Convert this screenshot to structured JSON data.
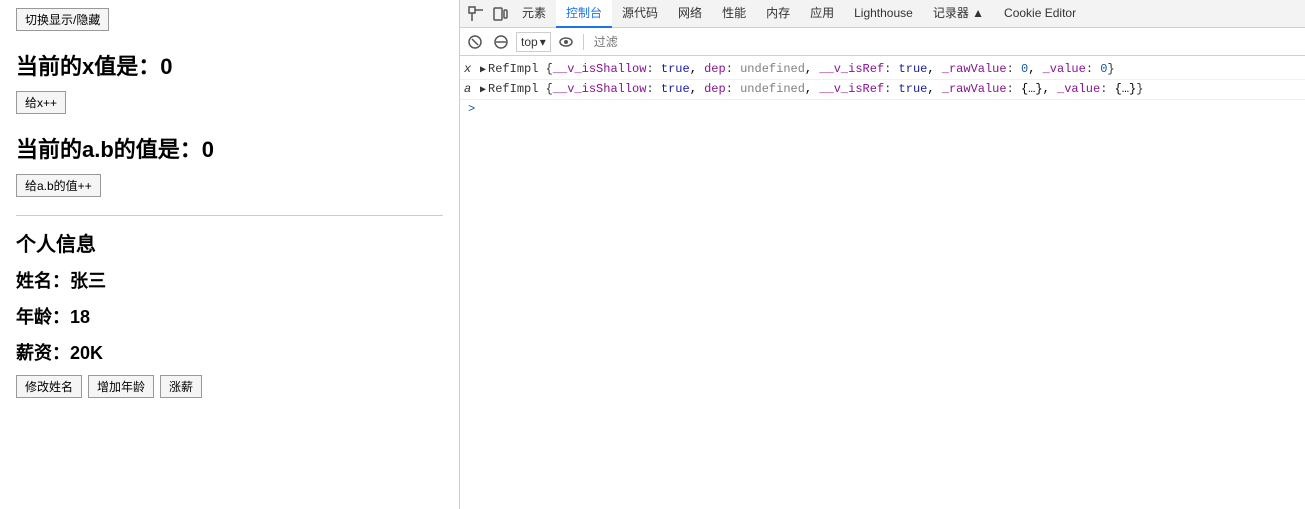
{
  "left": {
    "toggle_btn": "切换显示/隐藏",
    "current_x_label": "当前的x值是：",
    "current_x_value": "0",
    "x_increment_btn": "给x++",
    "current_ab_label": "当前的a.b的值是：",
    "current_ab_value": "0",
    "ab_increment_btn": "给a.b的值++",
    "section_title": "个人信息",
    "name_label": "姓名：张三",
    "age_label": "年龄：18",
    "salary_label": "薪资：20K",
    "btn_name": "修改姓名",
    "btn_age": "增加年龄",
    "btn_salary": "涨薪"
  },
  "devtools": {
    "tabs": [
      {
        "label": "元素",
        "active": false
      },
      {
        "label": "控制台",
        "active": true
      },
      {
        "label": "源代码",
        "active": false
      },
      {
        "label": "网络",
        "active": false
      },
      {
        "label": "性能",
        "active": false
      },
      {
        "label": "内存",
        "active": false
      },
      {
        "label": "应用",
        "active": false
      },
      {
        "label": "Lighthouse",
        "active": false
      },
      {
        "label": "记录器 ▲",
        "active": false
      },
      {
        "label": "Cookie Editor",
        "active": false
      }
    ],
    "toolbar": {
      "top_label": "top",
      "filter_placeholder": "过滤"
    },
    "console_rows": [
      {
        "key": "x",
        "content": "RefImpl {__v_isShallow: true, dep: undefined, __v_isRef: true, _rawValue: 0, _value: 0}"
      },
      {
        "key": "a",
        "content": "RefImpl {__v_isShallow: true, dep: undefined, __v_isRef: true, _rawValue: {...}, _value: {...}}"
      }
    ],
    "prompt": ">"
  }
}
